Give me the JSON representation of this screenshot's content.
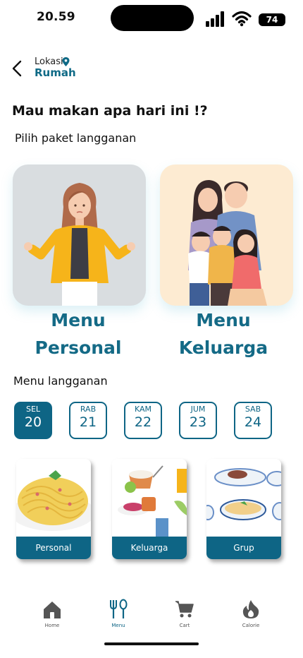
{
  "status": {
    "time": "20.59",
    "battery": "74"
  },
  "header": {
    "location_label": "Lokasi",
    "location_value": "Rumah"
  },
  "greeting": "Mau makan apa hari ini !?",
  "package_prompt": "Pilih paket langganan",
  "packages": [
    {
      "line1": "Menu",
      "line2": "Personal"
    },
    {
      "line1": "Menu",
      "line2": "Keluarga"
    }
  ],
  "subscription_title": "Menu langganan",
  "days": [
    {
      "name": "SEL",
      "num": "20",
      "active": true
    },
    {
      "name": "RAB",
      "num": "21",
      "active": false
    },
    {
      "name": "KAM",
      "num": "22",
      "active": false
    },
    {
      "name": "JUM",
      "num": "23",
      "active": false
    },
    {
      "name": "SAB",
      "num": "24",
      "active": false
    }
  ],
  "menu_cards": [
    {
      "label": "Personal"
    },
    {
      "label": "Keluarga"
    },
    {
      "label": "Grup"
    }
  ],
  "nav": [
    {
      "label": "Home",
      "icon": "home-icon",
      "active": false
    },
    {
      "label": "Menu",
      "icon": "fork-knife-icon",
      "active": true
    },
    {
      "label": "Cart",
      "icon": "cart-icon",
      "active": false
    },
    {
      "label": "Calorie",
      "icon": "flame-icon",
      "active": false
    }
  ],
  "colors": {
    "primary": "#0e6585",
    "title_teal": "#146a86",
    "personal_bg": "#d9dde0",
    "keluarga_bg": "#fdebd2"
  }
}
